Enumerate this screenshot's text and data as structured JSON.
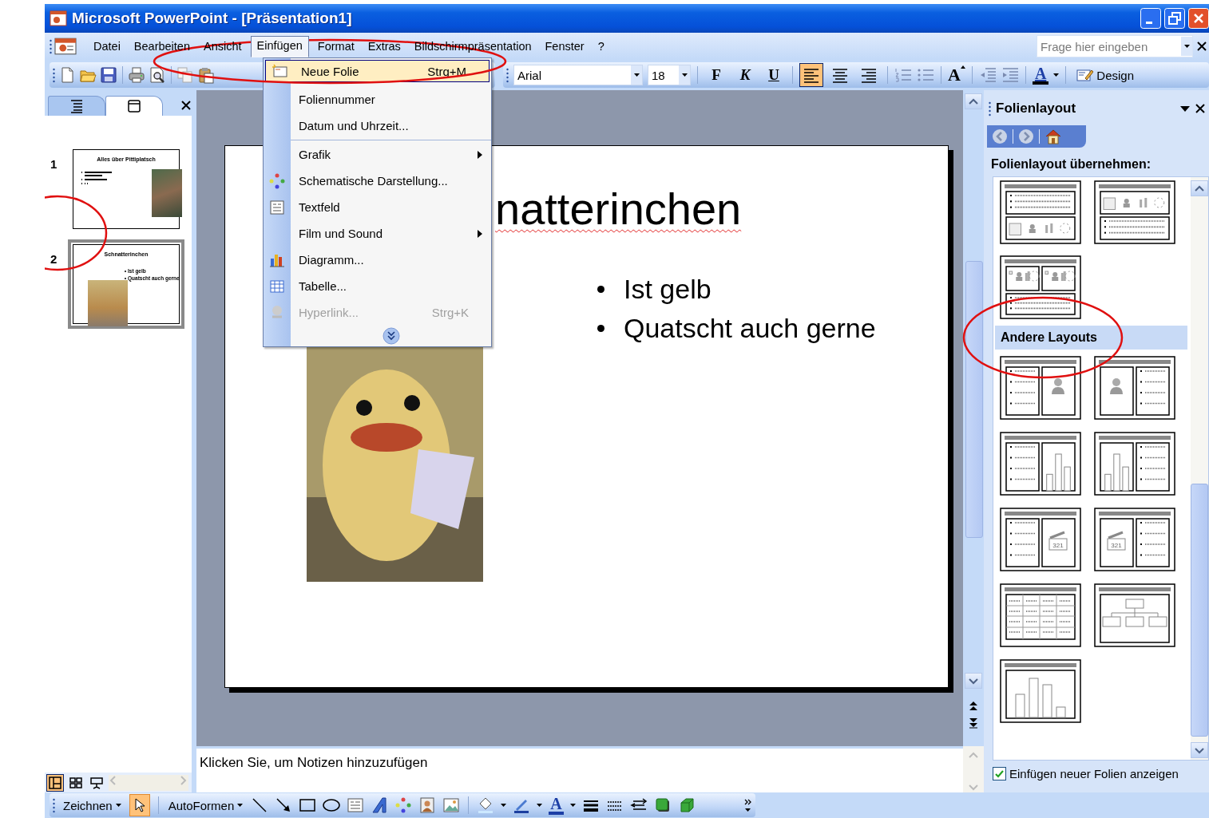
{
  "window": {
    "title": "Microsoft PowerPoint - [Präsentation1]"
  },
  "menu_bar": {
    "items": [
      {
        "label": "Datei",
        "selected": false
      },
      {
        "label": "Bearbeiten",
        "selected": false
      },
      {
        "label": "Ansicht",
        "selected": false
      },
      {
        "label": "Einfügen",
        "selected": true
      },
      {
        "label": "Format",
        "selected": false
      },
      {
        "label": "Extras",
        "selected": false
      },
      {
        "label": "Bildschirmpräsentation",
        "selected": false
      },
      {
        "label": "Fenster",
        "selected": false
      },
      {
        "label": "?",
        "selected": false
      }
    ],
    "help_field": {
      "placeholder": "Frage hier eingeben"
    }
  },
  "formatting_toolbar": {
    "font": "Arial",
    "size": "18",
    "style_buttons": [
      {
        "label": "F",
        "kind": "bold"
      },
      {
        "label": "K",
        "kind": "italic"
      },
      {
        "label": "U",
        "kind": "underline"
      }
    ],
    "align_buttons": [
      {
        "kind": "left",
        "selected": true
      },
      {
        "kind": "center",
        "selected": false
      },
      {
        "kind": "right",
        "selected": false
      }
    ],
    "grow_font_label": "A",
    "font_color_label": "A",
    "design_button": "Design"
  },
  "insert_menu": {
    "items": [
      {
        "label": "Neue Folie",
        "shortcut": "Strg+M",
        "kind": "new-slide",
        "highlighted": true,
        "disabled": false,
        "submenu": false
      },
      {
        "label": "Foliennummer",
        "kind": "plain",
        "highlighted": false,
        "disabled": false,
        "submenu": false
      },
      {
        "label": "Datum und Uhrzeit...",
        "kind": "plain",
        "highlighted": false,
        "disabled": false,
        "submenu": false,
        "separator_after": true
      },
      {
        "label": "Grafik",
        "kind": "plain",
        "highlighted": false,
        "disabled": false,
        "submenu": true
      },
      {
        "label": "Schematische Darstellung...",
        "kind": "diagram",
        "highlighted": false,
        "disabled": false,
        "submenu": false
      },
      {
        "label": "Textfeld",
        "kind": "textbox",
        "highlighted": false,
        "disabled": false,
        "submenu": false
      },
      {
        "label": "Film und Sound",
        "kind": "plain",
        "highlighted": false,
        "disabled": false,
        "submenu": true
      },
      {
        "label": "Diagramm...",
        "kind": "chart",
        "highlighted": false,
        "disabled": false,
        "submenu": false
      },
      {
        "label": "Tabelle...",
        "kind": "table",
        "highlighted": false,
        "disabled": false,
        "submenu": false
      },
      {
        "label": "Hyperlink...",
        "shortcut": "Strg+K",
        "kind": "link",
        "highlighted": false,
        "disabled": true,
        "submenu": false
      }
    ]
  },
  "slides_pane": {
    "tabs": [
      {
        "kind": "outline",
        "selected": false
      },
      {
        "kind": "slides",
        "selected": true
      }
    ],
    "slides": [
      {
        "number": "1",
        "title": "Alles über Pittiplatsch",
        "kind": "text-photo",
        "selected": false
      },
      {
        "number": "2",
        "title": "Schnatterinchen",
        "bullets": [
          "Ist gelb",
          "Quatscht auch gerne"
        ],
        "kind": "photo-text",
        "selected": true
      }
    ]
  },
  "slide": {
    "title": "natterinchen",
    "title_misspelled": true,
    "bullets": [
      "Ist gelb",
      "Quatscht auch gerne"
    ]
  },
  "notes": {
    "placeholder": "Klicken Sie, um Notizen hinzuzufügen"
  },
  "view_buttons": [
    {
      "kind": "normal",
      "selected": true
    },
    {
      "kind": "sorter",
      "selected": false
    },
    {
      "kind": "show",
      "selected": false
    }
  ],
  "task_pane": {
    "title": "Folienlayout",
    "heading": "Folienlayout übernehmen:",
    "layouts": [
      {
        "kind": "text-over-content"
      },
      {
        "kind": "content-over-text"
      },
      {
        "kind": "two-content-over-text"
      }
    ],
    "section": "Andere Layouts",
    "other_layouts": [
      {
        "kind": "text-clipart"
      },
      {
        "kind": "clipart-text"
      },
      {
        "kind": "text-chart"
      },
      {
        "kind": "chart-text"
      },
      {
        "kind": "text-media",
        "label": "321"
      },
      {
        "kind": "media-text",
        "label": "321"
      },
      {
        "kind": "table"
      },
      {
        "kind": "orgchart"
      },
      {
        "kind": "chart"
      }
    ],
    "show_on_insert": {
      "label": "Einfügen neuer Folien anzeigen",
      "checked": true
    }
  },
  "drawing_toolbar": {
    "draw_menu": "Zeichnen",
    "select_selected": true,
    "autoshapes_menu": "AutoFormen",
    "font_color_label": "A"
  }
}
